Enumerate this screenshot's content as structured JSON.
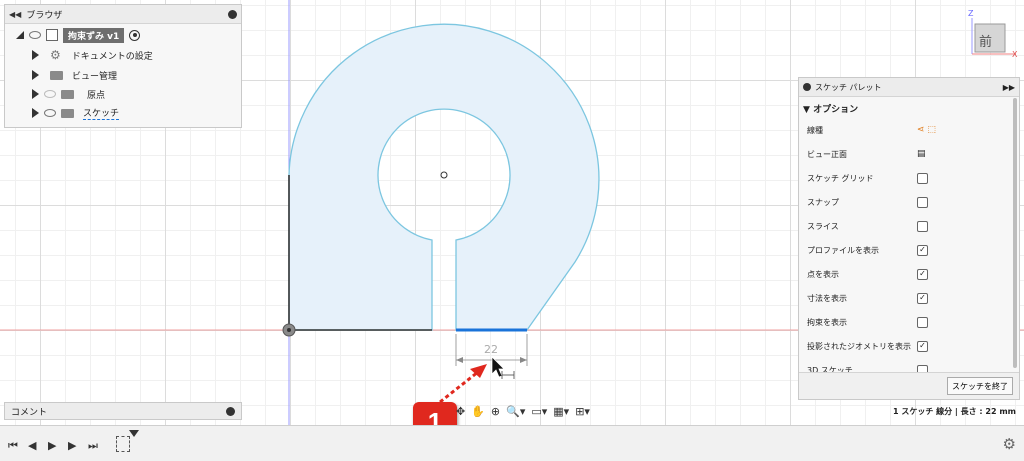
{
  "browser": {
    "title": "ブラウザ",
    "root_label": "拘束ずみ v1",
    "items": [
      {
        "label": "ドキュメントの設定"
      },
      {
        "label": "ビュー管理"
      },
      {
        "label": "原点"
      },
      {
        "label": "スケッチ"
      }
    ]
  },
  "viewcube": {
    "face": "前",
    "axis_z": "Z",
    "axis_x": "X"
  },
  "dimension": {
    "value": "22"
  },
  "callout": {
    "number": "1"
  },
  "comment": {
    "title": "コメント"
  },
  "palette": {
    "title": "スケッチ パレット",
    "section": "オプション",
    "rows": [
      {
        "label": "線種",
        "type": "icons"
      },
      {
        "label": "ビュー正面",
        "type": "icon"
      },
      {
        "label": "スケッチ グリッド",
        "checked": false
      },
      {
        "label": "スナップ",
        "checked": false
      },
      {
        "label": "スライス",
        "checked": false
      },
      {
        "label": "プロファイルを表示",
        "checked": true
      },
      {
        "label": "点を表示",
        "checked": true
      },
      {
        "label": "寸法を表示",
        "checked": true
      },
      {
        "label": "拘束を表示",
        "checked": false
      },
      {
        "label": "投影されたジオメトリを表示",
        "checked": true
      },
      {
        "label": "3D スケッチ",
        "checked": false
      }
    ],
    "finish_button": "スケッチを終了"
  },
  "status": {
    "text": "1 スケッチ 線分 | 長さ : 22 mm"
  },
  "colors": {
    "profile_fill": "#e6f1fa",
    "profile_stroke": "#7cc6e0",
    "selected_line": "#1a73d9",
    "callout": "#e0281e"
  }
}
